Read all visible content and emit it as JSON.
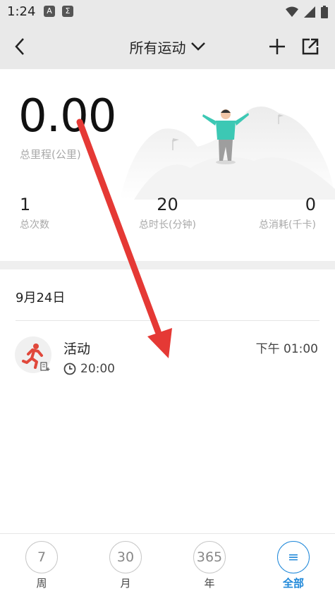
{
  "status_bar": {
    "time": "1:24",
    "badge1": "A",
    "badge2": "Σ"
  },
  "header": {
    "title": "所有运动"
  },
  "summary": {
    "distance_value": "0.00",
    "distance_label": "总里程(公里)",
    "stats": [
      {
        "value": "1",
        "label": "总次数"
      },
      {
        "value": "20",
        "label": "总时长(分钟)"
      },
      {
        "value": "0",
        "label": "总消耗(千卡)"
      }
    ]
  },
  "date_header": "9月24日",
  "activity": {
    "title": "活动",
    "time": "下午 01:00",
    "duration": "20:00"
  },
  "bottom_nav": [
    {
      "icon_text": "7",
      "label": "周"
    },
    {
      "icon_text": "30",
      "label": "月"
    },
    {
      "icon_text": "365",
      "label": "年"
    },
    {
      "icon_text": "≡",
      "label": "全部"
    }
  ],
  "colors": {
    "accent": "#1f88d9",
    "activity_red": "#e0483b",
    "arrow_red": "#e53935"
  }
}
